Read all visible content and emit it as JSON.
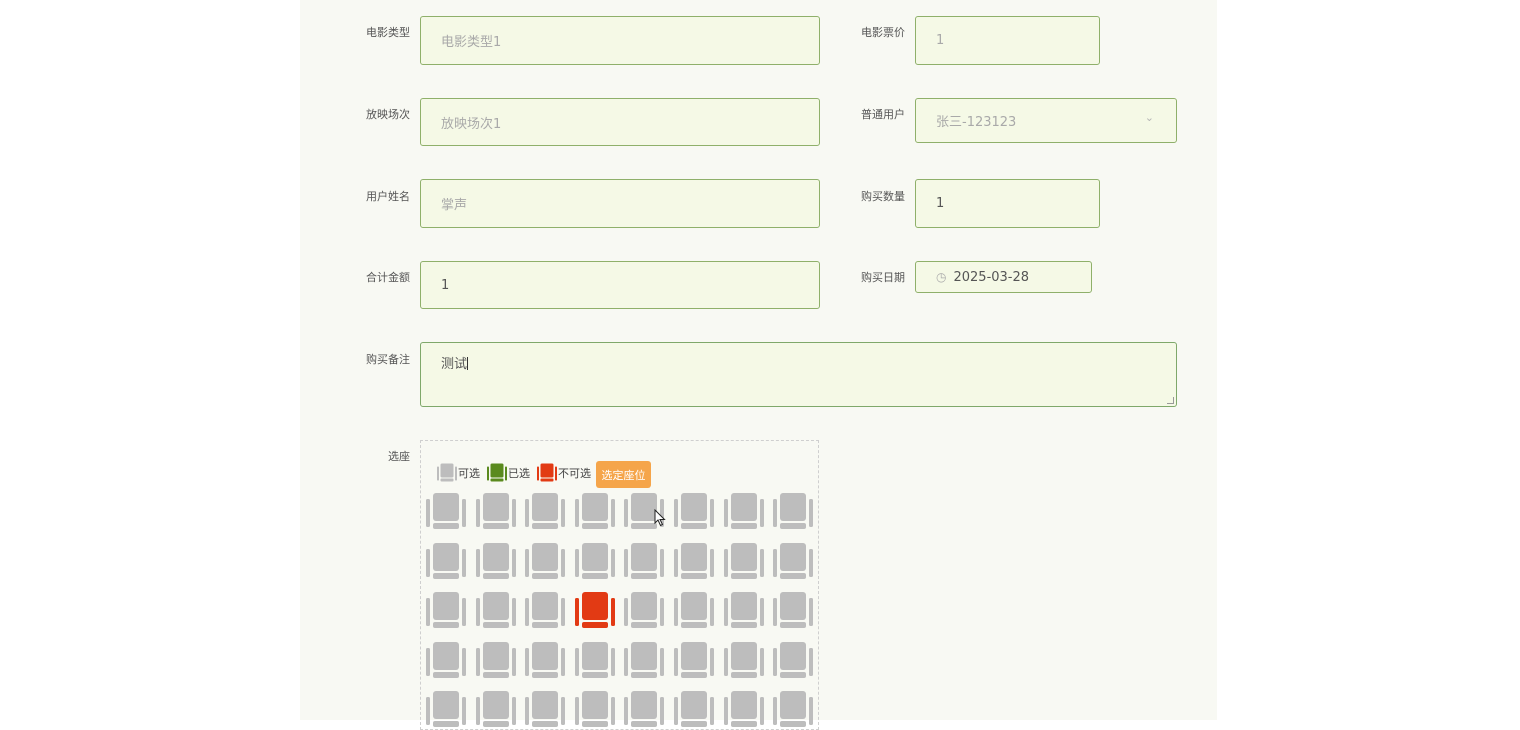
{
  "form": {
    "movie_type": {
      "label": "电影类型",
      "placeholder": "电影类型1"
    },
    "ticket_price": {
      "label": "电影票价",
      "placeholder": "1"
    },
    "showing": {
      "label": "放映场次",
      "placeholder": "放映场次1"
    },
    "regular_user": {
      "label": "普通用户",
      "value": "张三-123123"
    },
    "user_name": {
      "label": "用户姓名",
      "placeholder": "掌声"
    },
    "quantity": {
      "label": "购买数量",
      "value": "1"
    },
    "total": {
      "label": "合计金额",
      "value": "1"
    },
    "purchase_date": {
      "label": "购买日期",
      "value": "2025-03-28"
    },
    "remark": {
      "label": "购买备注",
      "value": "测试"
    }
  },
  "seat_selection": {
    "label": "选座",
    "legend": {
      "available": "可选",
      "selected": "已选",
      "unavailable": "不可选"
    },
    "select_button": "选定座位",
    "columns": 8,
    "rows_visible": 5,
    "unavailable_seats": [
      [
        2,
        3
      ]
    ],
    "colors": {
      "available": "#bdbdbd",
      "selected": "#5a8a1e",
      "unavailable": "#e23a14",
      "button": "#f5a54a"
    }
  }
}
